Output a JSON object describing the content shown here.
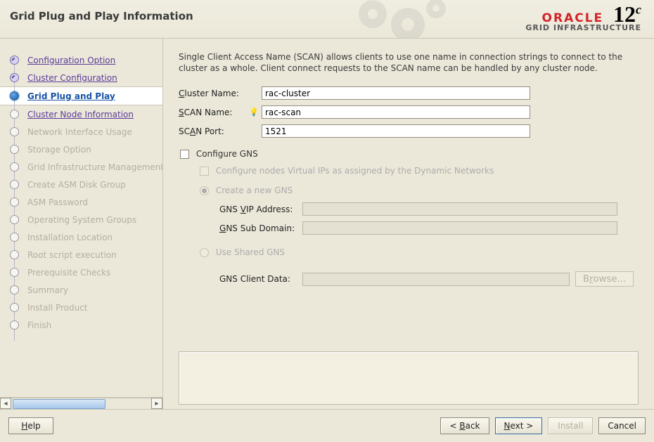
{
  "header": {
    "title": "Grid Plug and Play Information",
    "brand_top": "ORACLE",
    "brand_sub": "GRID INFRASTRUCTURE",
    "brand_version": "12",
    "brand_version_sup": "c"
  },
  "sidebar": {
    "steps": [
      {
        "label": "Configuration Option",
        "state": "done-link"
      },
      {
        "label": "Cluster Configuration",
        "state": "done-link"
      },
      {
        "label": "Grid Plug and Play",
        "state": "current"
      },
      {
        "label": "Cluster Node Information",
        "state": "link"
      },
      {
        "label": "Network Interface Usage",
        "state": "muted"
      },
      {
        "label": "Storage Option",
        "state": "muted"
      },
      {
        "label": "Grid Infrastructure Management",
        "state": "muted"
      },
      {
        "label": "Create ASM Disk Group",
        "state": "muted"
      },
      {
        "label": "ASM Password",
        "state": "muted"
      },
      {
        "label": "Operating System Groups",
        "state": "muted"
      },
      {
        "label": "Installation Location",
        "state": "muted"
      },
      {
        "label": "Root script execution",
        "state": "muted"
      },
      {
        "label": "Prerequisite Checks",
        "state": "muted"
      },
      {
        "label": "Summary",
        "state": "muted"
      },
      {
        "label": "Install Product",
        "state": "muted"
      },
      {
        "label": "Finish",
        "state": "muted"
      }
    ]
  },
  "main": {
    "intro": "Single Client Access Name (SCAN) allows clients to use one name in connection strings to connect to the cluster as a whole. Client connect requests to the SCAN name can be handled by any cluster node.",
    "cluster_name_label": "Cluster Name:",
    "cluster_name_value": "rac-cluster",
    "scan_name_label": "SCAN Name:",
    "scan_name_value": "rac-scan",
    "scan_port_label": "SCAN Port:",
    "scan_port_value": "1521",
    "configure_gns_label": "Configure GNS",
    "gns_virtual_ips_label": "Configure nodes Virtual IPs as assigned by the Dynamic Networks",
    "create_new_gns_label": "Create a new GNS",
    "gns_vip_label": "GNS VIP Address:",
    "gns_subdomain_label": "GNS Sub Domain:",
    "use_shared_gns_label": "Use Shared GNS",
    "gns_client_data_label": "GNS Client Data:",
    "browse_label": "Browse..."
  },
  "footer": {
    "help": "Help",
    "back": "< Back",
    "next": "Next >",
    "install": "Install",
    "cancel": "Cancel"
  }
}
